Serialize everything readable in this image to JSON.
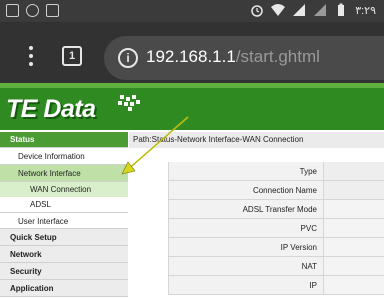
{
  "status_bar": {
    "time": "٣:٢٩",
    "icons": [
      "notification-app-icon",
      "notification-app-icon",
      "notification-app-icon",
      "alarm-icon",
      "wifi-icon",
      "cellular-signal-icon",
      "cellular-signal-icon",
      "battery-icon"
    ]
  },
  "browser": {
    "url_host": "192.168.1.1",
    "url_path": "/start.ghtml",
    "tab_count": "1"
  },
  "banner": {
    "logo_text": "TE Data"
  },
  "sidebar": {
    "items": [
      {
        "label": "Status"
      },
      {
        "label": "Device Information"
      },
      {
        "label": "Network Interface"
      },
      {
        "label": "WAN Connection"
      },
      {
        "label": "ADSL"
      },
      {
        "label": "User Interface"
      },
      {
        "label": "Quick Setup"
      },
      {
        "label": "Network"
      },
      {
        "label": "Security"
      },
      {
        "label": "Application"
      }
    ]
  },
  "path": "Path:Status-Network Interface-WAN Connection",
  "table": {
    "rows": [
      {
        "label": "Type"
      },
      {
        "label": "Connection Name"
      },
      {
        "label": "ADSL Transfer Mode"
      },
      {
        "label": "PVC"
      },
      {
        "label": "IP Version"
      },
      {
        "label": "NAT"
      },
      {
        "label": "IP"
      }
    ]
  },
  "colors": {
    "brand_green": "#2f8a22",
    "menu_active": "#bfe1a8",
    "annotation_arrow": "#d8d81a"
  }
}
